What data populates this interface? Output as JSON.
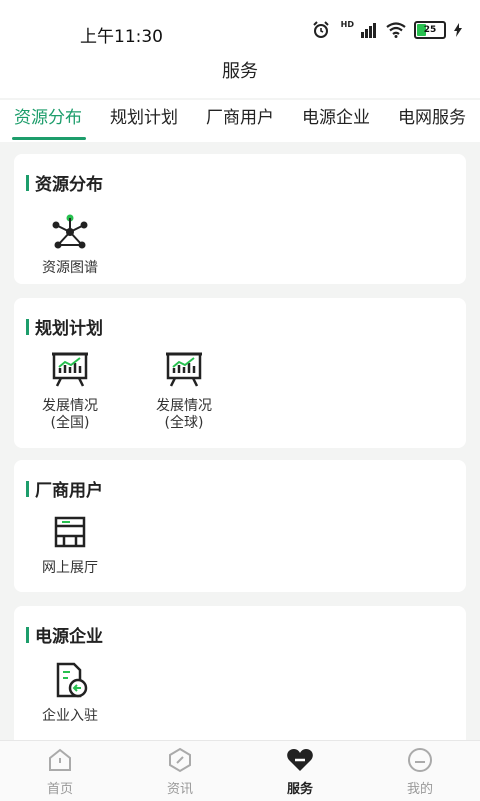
{
  "status_bar": {
    "time": "上午11:30",
    "network": "HD",
    "battery": "25"
  },
  "header": {
    "title": "服务"
  },
  "tabs": [
    {
      "label": "资源分布",
      "active": true
    },
    {
      "label": "规划计划",
      "active": false
    },
    {
      "label": "厂商用户",
      "active": false
    },
    {
      "label": "电源企业",
      "active": false
    },
    {
      "label": "电网服务",
      "active": false
    }
  ],
  "sections": [
    {
      "title": "资源分布",
      "items": [
        {
          "label": "资源图谱",
          "icon": "resource-graph-icon"
        }
      ]
    },
    {
      "title": "规划计划",
      "items": [
        {
          "label": "发展情况\n(全国)",
          "icon": "development-chart-icon"
        },
        {
          "label": "发展情况\n(全球)",
          "icon": "development-chart-icon"
        }
      ]
    },
    {
      "title": "厂商用户",
      "items": [
        {
          "label": "网上展厅",
          "icon": "online-hall-icon"
        }
      ]
    },
    {
      "title": "电源企业",
      "items": [
        {
          "label": "企业入驻",
          "icon": "enterprise-entry-icon"
        }
      ]
    }
  ],
  "bottom_nav": [
    {
      "label": "首页",
      "icon": "home-icon",
      "active": false
    },
    {
      "label": "资讯",
      "icon": "news-icon",
      "active": false
    },
    {
      "label": "服务",
      "icon": "service-heart-icon",
      "active": true
    },
    {
      "label": "我的",
      "icon": "profile-icon",
      "active": false
    }
  ],
  "colors": {
    "accent": "#1d9d6b",
    "icon_green": "#27c04f",
    "text": "#222222"
  }
}
